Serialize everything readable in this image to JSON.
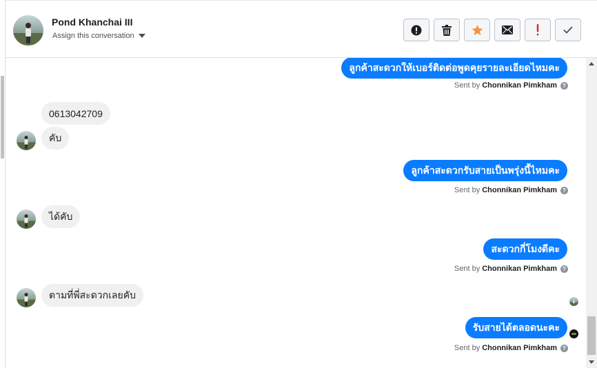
{
  "header": {
    "contact_name": "Pond Khanchai III",
    "assign_label": "Assign this conversation",
    "actions": [
      {
        "name": "mark-spam-button",
        "icon": "alert-circle-icon"
      },
      {
        "name": "delete-button",
        "icon": "trash-icon"
      },
      {
        "name": "star-button",
        "icon": "star-icon"
      },
      {
        "name": "mark-unread-button",
        "icon": "envelope-icon"
      },
      {
        "name": "follow-up-button",
        "icon": "exclamation-icon"
      },
      {
        "name": "mark-done-button",
        "icon": "check-icon"
      }
    ]
  },
  "messages": [
    {
      "direction": "out",
      "text": "ลูกค้าสะดวกให้เบอร์ติดต่อพูดคุยรายละเอียดไหมคะ",
      "sent_by_prefix": "Sent by",
      "sent_by": "Chonnikan Pimkham"
    },
    {
      "direction": "in",
      "text": "0613042709"
    },
    {
      "direction": "in",
      "text": "คับ"
    },
    {
      "direction": "out",
      "text": "ลูกค้าสะดวกรับสายเป็นพรุ่งนี้ไหมคะ",
      "sent_by_prefix": "Sent by",
      "sent_by": "Chonnikan Pimkham"
    },
    {
      "direction": "in",
      "text": "ได้คับ"
    },
    {
      "direction": "out",
      "text": "สะดวกกี่โมงดีคะ",
      "sent_by_prefix": "Sent by",
      "sent_by": "Chonnikan Pimkham"
    },
    {
      "direction": "in",
      "text": "ตามที่พี่สะดวกเลยคับ"
    },
    {
      "direction": "out",
      "text": "รับสายได้ตลอดนะคะ",
      "sent_by_prefix": "Sent by",
      "sent_by": "Chonnikan Pimkham"
    }
  ],
  "colors": {
    "outgoing_bubble": "#0a7cff",
    "incoming_bubble": "#f1f0f0",
    "star": "#f7923a",
    "follow_up": "#e02020"
  }
}
